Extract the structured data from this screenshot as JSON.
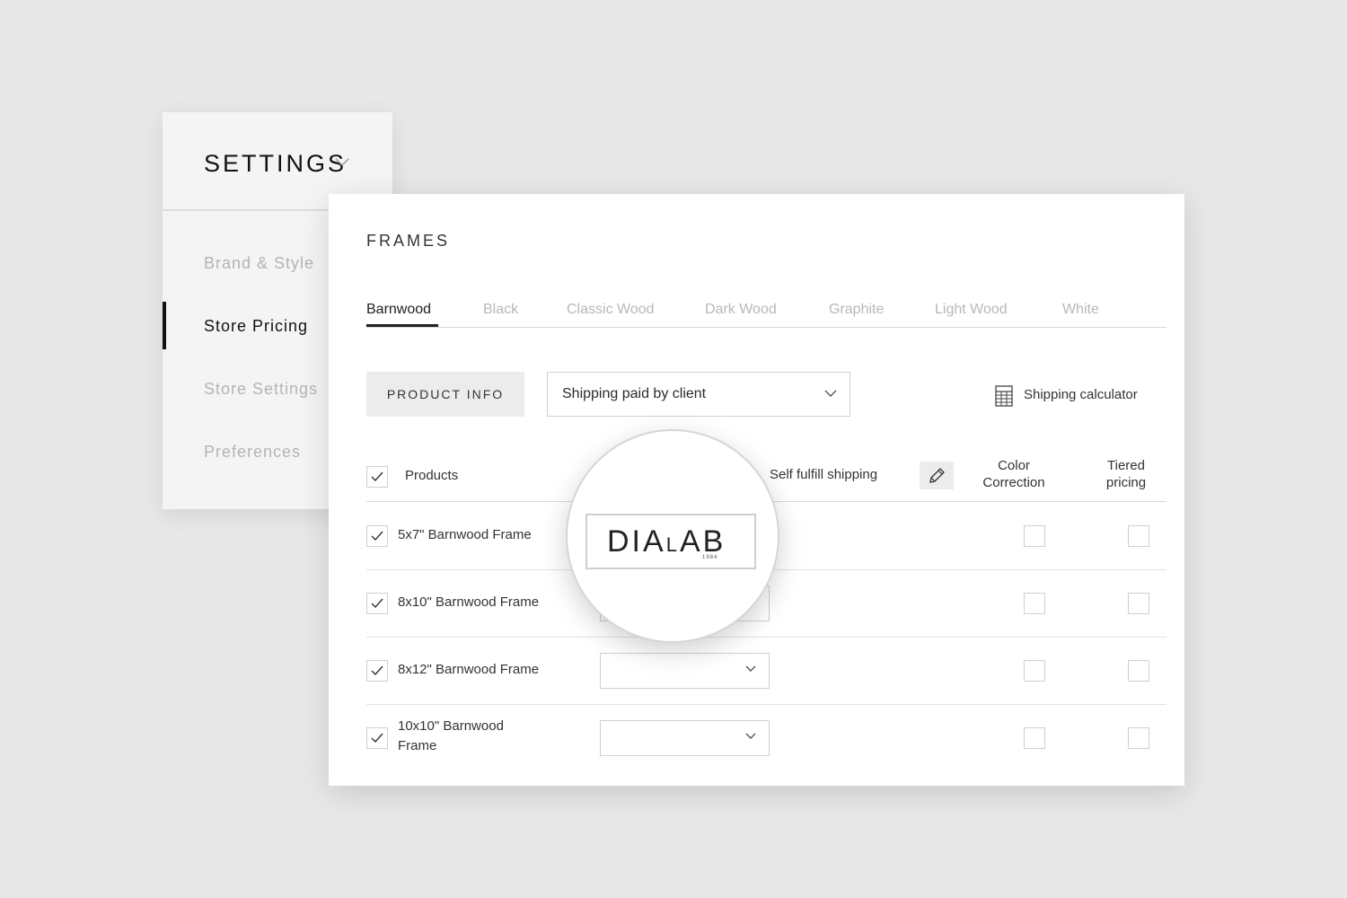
{
  "settings": {
    "title": "SETTINGS",
    "nav": [
      {
        "label": "Brand & Style",
        "active": false
      },
      {
        "label": "Store Pricing",
        "active": true
      },
      {
        "label": "Store Settings",
        "active": false
      },
      {
        "label": "Preferences",
        "active": false
      }
    ]
  },
  "panel": {
    "title": "FRAMES",
    "tabs": [
      "Barnwood",
      "Black",
      "Classic Wood",
      "Dark Wood",
      "Graphite",
      "Light Wood",
      "White"
    ],
    "active_tab": "Barnwood",
    "product_info_label": "PRODUCT INFO",
    "shipping_select_value": "Shipping paid by client",
    "shipping_calculator_label": "Shipping calculator",
    "columns": {
      "products": "Products",
      "self_fulfill": "Self fulfill shipping",
      "color_correction_1": "Color",
      "color_correction_2": "Correction",
      "tiered_1": "Tiered",
      "tiered_2": "pricing"
    },
    "rows": [
      {
        "name": "5x7\" Barnwood Frame",
        "checked": true
      },
      {
        "name": "8x10\" Barnwood Frame",
        "checked": true
      },
      {
        "name": "8x12\" Barnwood Frame",
        "checked": true
      },
      {
        "name_line1": "10x10\" Barnwood",
        "name_line2": "Frame",
        "checked": true
      }
    ]
  },
  "magnifier": {
    "logo_part1": "DIA",
    "logo_part2": "L",
    "logo_part3": "AB",
    "logo_year": "1984"
  },
  "colors": {
    "background": "#e8e8e8",
    "panel": "#ffffff",
    "sidebar": "#f4f4f4",
    "accent": "#111111"
  }
}
